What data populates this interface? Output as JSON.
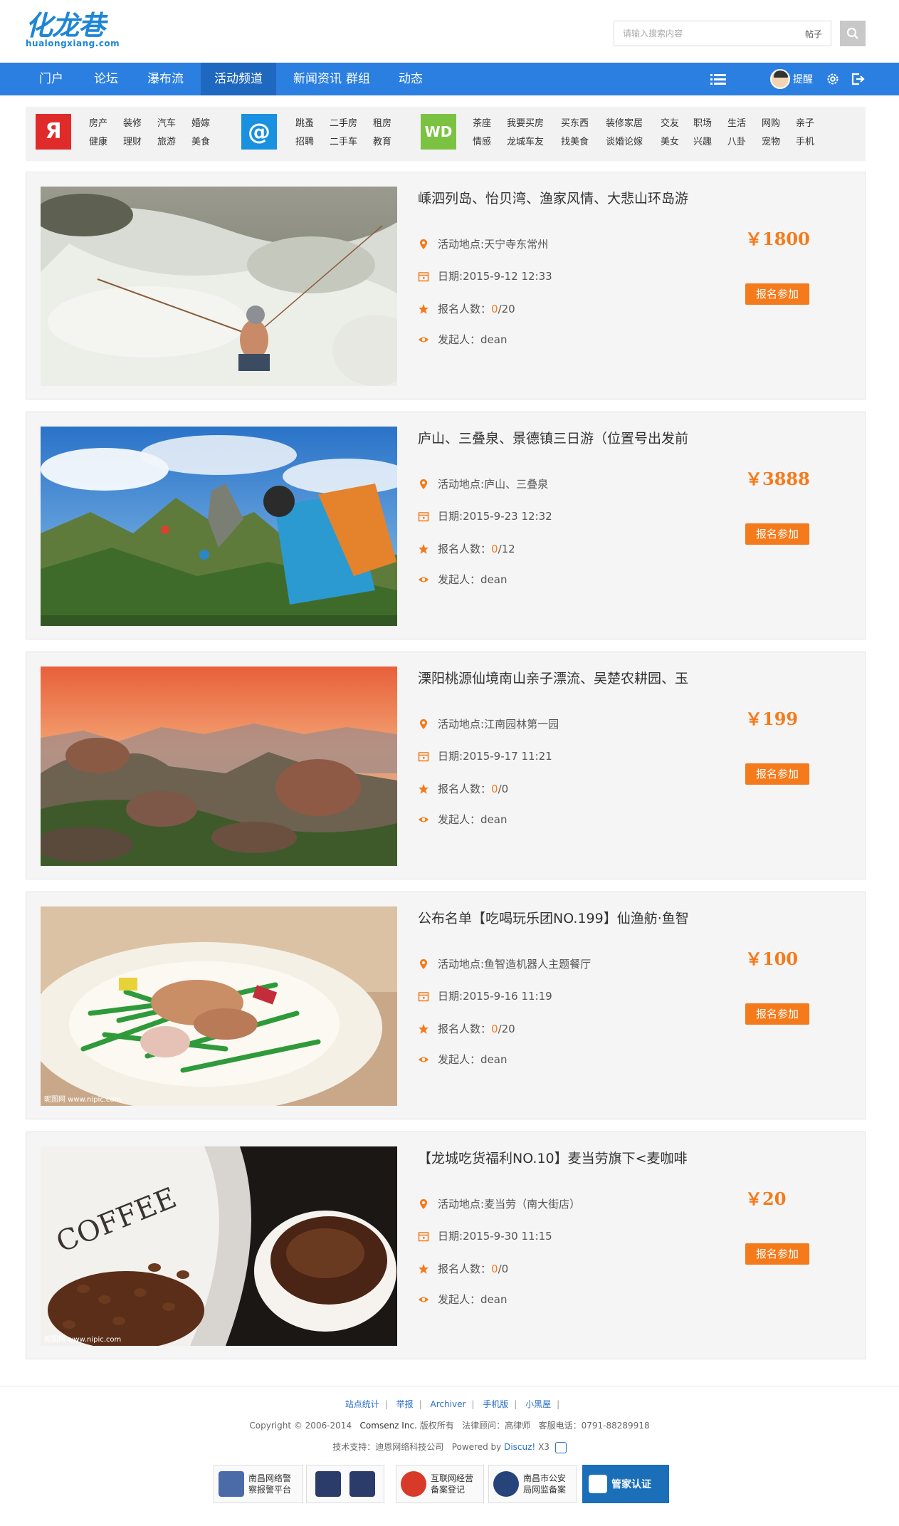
{
  "header": {
    "logo_text": "化龙巷",
    "logo_sub": "hualongxiang.com",
    "search_placeholder": "请输入搜索内容",
    "search_type": "帖子"
  },
  "nav": {
    "items": [
      "门户",
      "论坛",
      "瀑布流",
      "活动频道",
      "新闻资讯",
      "群组",
      "动态"
    ],
    "active_index": 3,
    "remind_label": "提醒"
  },
  "categories": {
    "group1": {
      "icon_text": "Я",
      "color": "#e02b2b",
      "links": [
        "房产",
        "装修",
        "汽车",
        "婚嫁",
        "健康",
        "理财",
        "旅游",
        "美食"
      ]
    },
    "group2": {
      "icon_text": "@",
      "color": "#1a90e0",
      "links": [
        "跳蚤",
        "二手房",
        "租房",
        "招聘",
        "二手车",
        "教育"
      ]
    },
    "group3": {
      "icon_text": "WD",
      "color": "#7cc242",
      "links": [
        "茶座",
        "我要买房",
        "买东西",
        "装修家居",
        "交友",
        "职场",
        "生活",
        "网购",
        "亲子",
        "情感",
        "龙城车友",
        "找美食",
        "谈婚论嫁",
        "美女",
        "兴趣",
        "八卦",
        "宠物",
        "手机"
      ]
    }
  },
  "labels": {
    "location": "活动地点: ",
    "date_prefix": "日期:",
    "count_prefix": "报名人数：",
    "initiator_prefix": "发起人：",
    "join": "报名参加"
  },
  "activities": [
    {
      "title": "嵊泗列岛、怡贝湾、渔家风情、大悲山环岛游",
      "location": "天宁寺东常州",
      "date": "2015-9-12 12:33",
      "joined": "0",
      "limit": "/20",
      "initiator": "dean",
      "price": "￥1800"
    },
    {
      "title": "庐山、三叠泉、景德镇三日游（位置号出发前",
      "location": "庐山、三叠泉",
      "date": "2015-9-23 12:32",
      "joined": "0",
      "limit": "/12",
      "initiator": "dean",
      "price": "￥3888"
    },
    {
      "title": "溧阳桃源仙境南山亲子漂流、吴楚农耕园、玉",
      "location": "江南园林第一园",
      "date": "2015-9-17 11:21",
      "joined": "0",
      "limit": "/0",
      "initiator": "dean",
      "price": "￥199"
    },
    {
      "title": "公布名单【吃喝玩乐团NO.199】仙渔舫·鱼智",
      "location": "鱼智造机器人主题餐厅",
      "date": "2015-9-16 11:19",
      "joined": "0",
      "limit": "/20",
      "initiator": "dean",
      "price": "￥100"
    },
    {
      "title": "【龙城吃货福利NO.10】麦当劳旗下<麦咖啡",
      "location": "麦当劳（南大街店）",
      "date": "2015-9-30 11:15",
      "joined": "0",
      "limit": "/0",
      "initiator": "dean",
      "price": "￥20"
    }
  ],
  "image_watermarks": {
    "food": "昵图网 www.nipic.com",
    "coffee_text": "COFFEE",
    "coffee_mark": "昵图网 www.nipic.com"
  },
  "footer": {
    "links": [
      "站点统计",
      "举报",
      "Archiver",
      "手机版",
      "小黑屋"
    ],
    "copyright": "Copyright © 2006-2014",
    "company": "Comsenz Inc.",
    "rights": "版权所有",
    "legal": "法律顾问：高律师",
    "hotline": "客服电话：0791-88289918",
    "tech": "技术支持：迪恩网络科技公司",
    "powered_label": "Powered by",
    "powered_by": "Discuz!",
    "version": "X3",
    "badges": [
      {
        "line1": "南昌网络警",
        "line2": "察报警平台"
      },
      {
        "line1": "",
        "line2": ""
      },
      {
        "line1": "互联网经营",
        "line2": "备案登记"
      },
      {
        "line1": "南昌市公安",
        "line2": "局网监备案"
      },
      {
        "line1": "管家认证",
        "line2": ""
      }
    ]
  }
}
